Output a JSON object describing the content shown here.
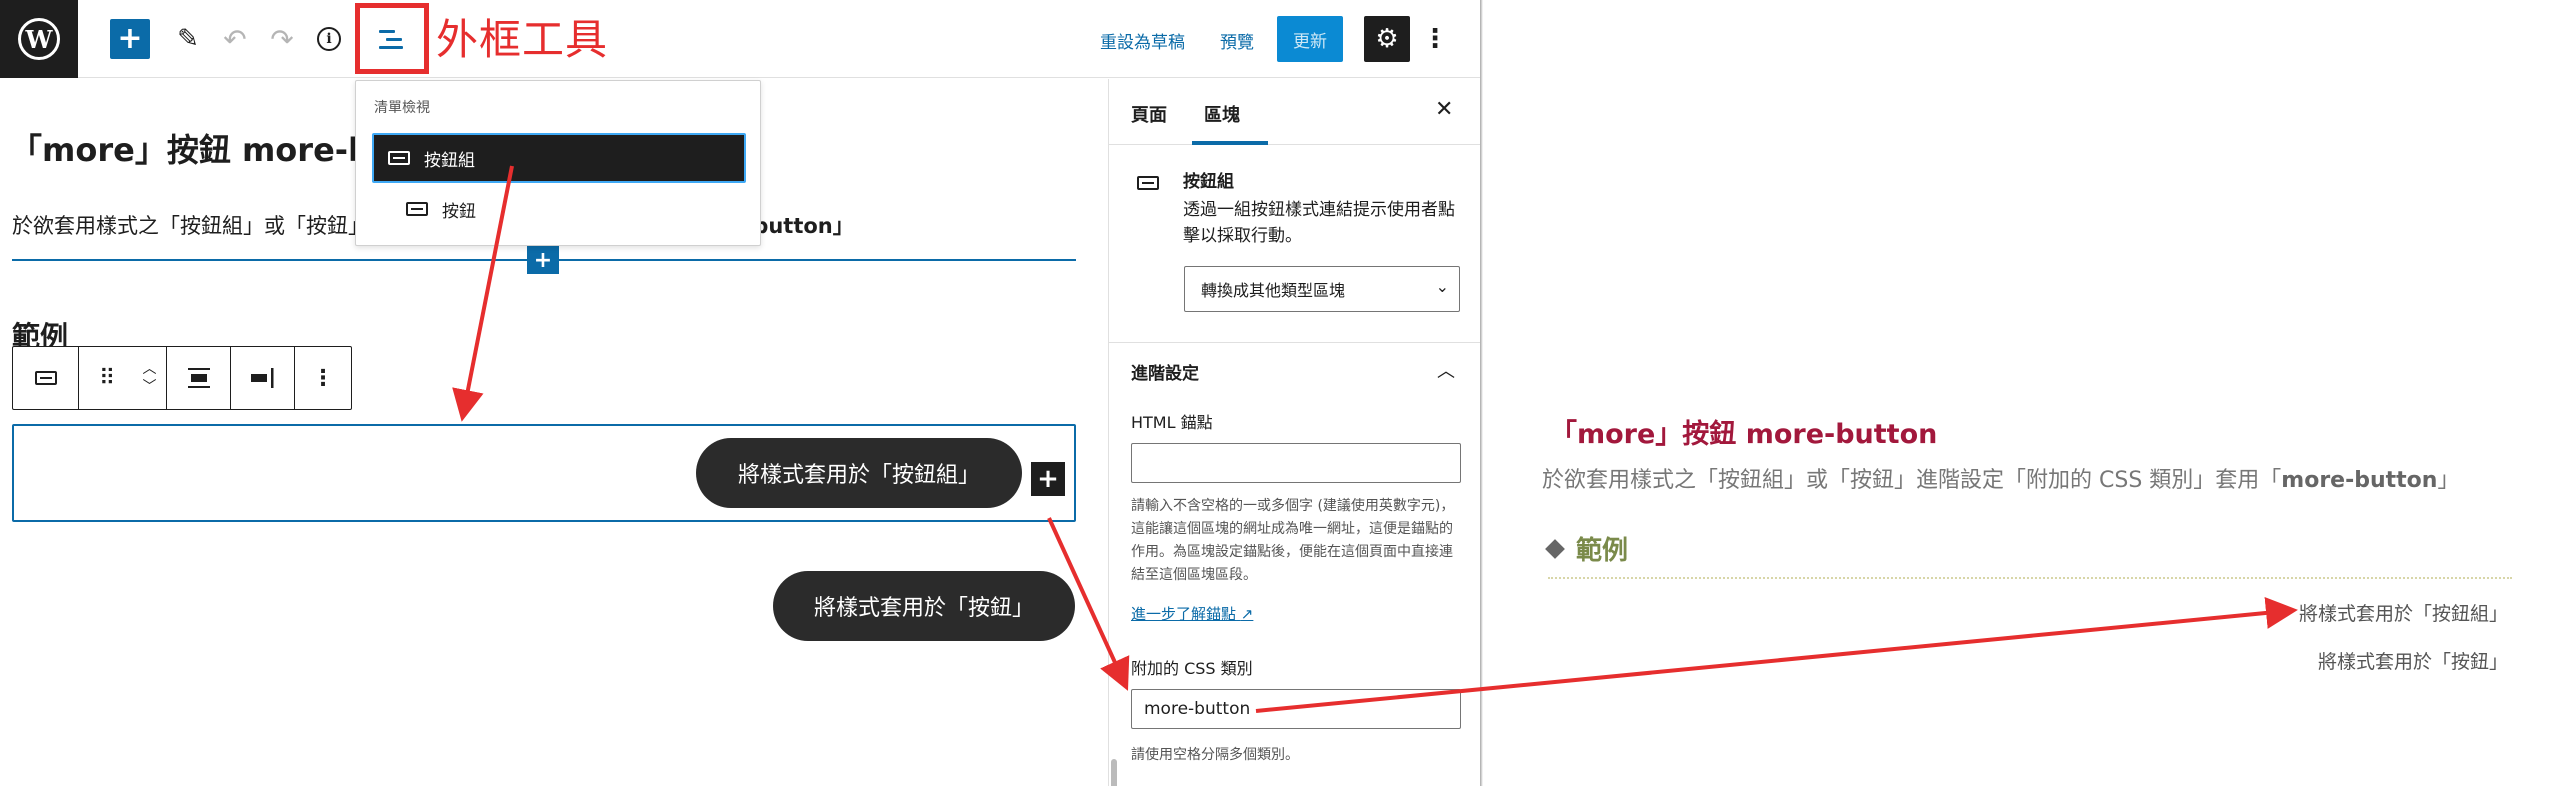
{
  "toolbar": {
    "outline_callout": "外框工具",
    "save_draft": "重設為草稿",
    "preview": "預覽",
    "update": "更新"
  },
  "list_view": {
    "title": "清單檢視",
    "items": [
      {
        "label": "按鈕組",
        "selected": true
      },
      {
        "label": "按鈕",
        "selected": false
      }
    ]
  },
  "canvas": {
    "title": "「more」按鈕 more-bu",
    "paragraph_start": "於欲套用樣式之「按鈕組」或「按鈕」",
    "paragraph_end": "re-button」",
    "example_heading": "範例",
    "pill_group": "將樣式套用於「按鈕組」",
    "pill_button": "將樣式套用於「按鈕」"
  },
  "sidebar": {
    "tabs": [
      "頁面",
      "區塊"
    ],
    "active_tab": "區塊",
    "block_name": "按鈕組",
    "block_description": "透過一組按鈕樣式連結提示使用者點擊以採取行動。",
    "transform_label": "轉換成其他類型區塊",
    "advanced_title": "進階設定",
    "html_anchor_label": "HTML 錨點",
    "html_anchor_value": "",
    "html_anchor_help": "請輸入不含空格的一或多個字 (建議使用英數字元)，這能讓這個區塊的網址成為唯一網址，這便是錨點的作用。為區塊設定錨點後，便能在這個頁面中直接連結至這個區塊區段。",
    "learn_more_link": "進一步了解錨點",
    "css_class_label": "附加的 CSS 類別",
    "css_class_value": "more-button",
    "css_class_help": "請使用空格分隔多個類別。"
  },
  "preview": {
    "title": "「more」按鈕 more-button",
    "paragraph_plain": "於欲套用樣式之「按鈕組」或「按鈕」進階設定「附加的 CSS 類別」套用「",
    "paragraph_bold": "more-button",
    "paragraph_close": "」",
    "heading": "範例",
    "link_group": "將樣式套用於「按鈕組」",
    "link_button": "將樣式套用於「按鈕」"
  },
  "colors": {
    "accent_blue": "#0b6ba8",
    "annotation_red": "#e62e2e",
    "preview_title": "#a2183c",
    "preview_heading": "#7a8a4a"
  }
}
